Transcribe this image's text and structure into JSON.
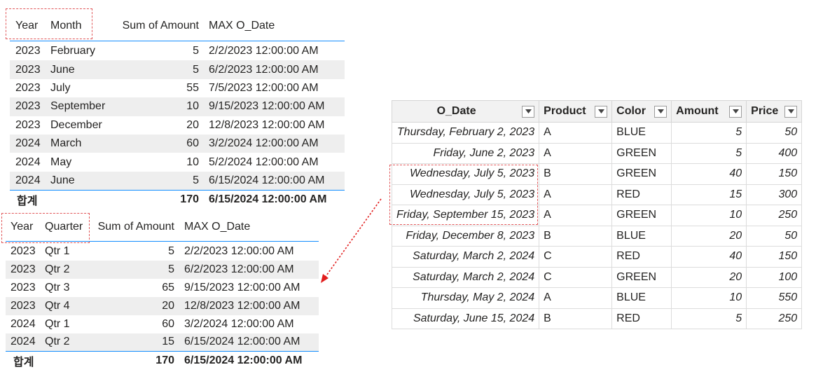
{
  "month_table": {
    "headers": {
      "year": "Year",
      "month": "Month",
      "sum": "Sum of Amount",
      "max": "MAX O_Date"
    },
    "rows": [
      {
        "year": "2023",
        "period": "February",
        "sum": "5",
        "max": "2/2/2023 12:00:00 AM"
      },
      {
        "year": "2023",
        "period": "June",
        "sum": "5",
        "max": "6/2/2023 12:00:00 AM"
      },
      {
        "year": "2023",
        "period": "July",
        "sum": "55",
        "max": "7/5/2023 12:00:00 AM"
      },
      {
        "year": "2023",
        "period": "September",
        "sum": "10",
        "max": "9/15/2023 12:00:00 AM"
      },
      {
        "year": "2023",
        "period": "December",
        "sum": "20",
        "max": "12/8/2023 12:00:00 AM"
      },
      {
        "year": "2024",
        "period": "March",
        "sum": "60",
        "max": "3/2/2024 12:00:00 AM"
      },
      {
        "year": "2024",
        "period": "May",
        "sum": "10",
        "max": "5/2/2024 12:00:00 AM"
      },
      {
        "year": "2024",
        "period": "June",
        "sum": "5",
        "max": "6/15/2024 12:00:00 AM"
      }
    ],
    "total": {
      "label": "합계",
      "sum": "170",
      "max": "6/15/2024 12:00:00 AM"
    }
  },
  "quarter_table": {
    "headers": {
      "year": "Year",
      "quarter": "Quarter",
      "sum": "Sum of Amount",
      "max": "MAX O_Date"
    },
    "rows": [
      {
        "year": "2023",
        "period": "Qtr 1",
        "sum": "5",
        "max": "2/2/2023 12:00:00 AM"
      },
      {
        "year": "2023",
        "period": "Qtr 2",
        "sum": "5",
        "max": "6/2/2023 12:00:00 AM"
      },
      {
        "year": "2023",
        "period": "Qtr 3",
        "sum": "65",
        "max": "9/15/2023 12:00:00 AM"
      },
      {
        "year": "2023",
        "period": "Qtr 4",
        "sum": "20",
        "max": "12/8/2023 12:00:00 AM"
      },
      {
        "year": "2024",
        "period": "Qtr 1",
        "sum": "60",
        "max": "3/2/2024 12:00:00 AM"
      },
      {
        "year": "2024",
        "period": "Qtr 2",
        "sum": "15",
        "max": "6/15/2024 12:00:00 AM"
      }
    ],
    "total": {
      "label": "합계",
      "sum": "170",
      "max": "6/15/2024 12:00:00 AM"
    }
  },
  "data_table": {
    "headers": [
      "O_Date",
      "Product",
      "Color",
      "Amount",
      "Price"
    ],
    "rows": [
      [
        "Thursday, February 2, 2023",
        "A",
        "BLUE",
        "5",
        "50"
      ],
      [
        "Friday, June 2, 2023",
        "A",
        "GREEN",
        "5",
        "400"
      ],
      [
        "Wednesday, July 5, 2023",
        "B",
        "GREEN",
        "40",
        "150"
      ],
      [
        "Wednesday, July 5, 2023",
        "A",
        "RED",
        "15",
        "300"
      ],
      [
        "Friday, September 15, 2023",
        "A",
        "GREEN",
        "10",
        "250"
      ],
      [
        "Friday, December 8, 2023",
        "B",
        "BLUE",
        "20",
        "50"
      ],
      [
        "Saturday, March 2, 2024",
        "C",
        "RED",
        "40",
        "150"
      ],
      [
        "Saturday, March 2, 2024",
        "C",
        "GREEN",
        "20",
        "100"
      ],
      [
        "Thursday, May 2, 2024",
        "A",
        "BLUE",
        "10",
        "550"
      ],
      [
        "Saturday, June 15, 2024",
        "B",
        "RED",
        "5",
        "250"
      ]
    ],
    "filter_icon": "dropdown-filter-icon"
  },
  "colors": {
    "accent_line": "#118dff",
    "annotation": "#e15759",
    "band": "#eeeeee"
  }
}
